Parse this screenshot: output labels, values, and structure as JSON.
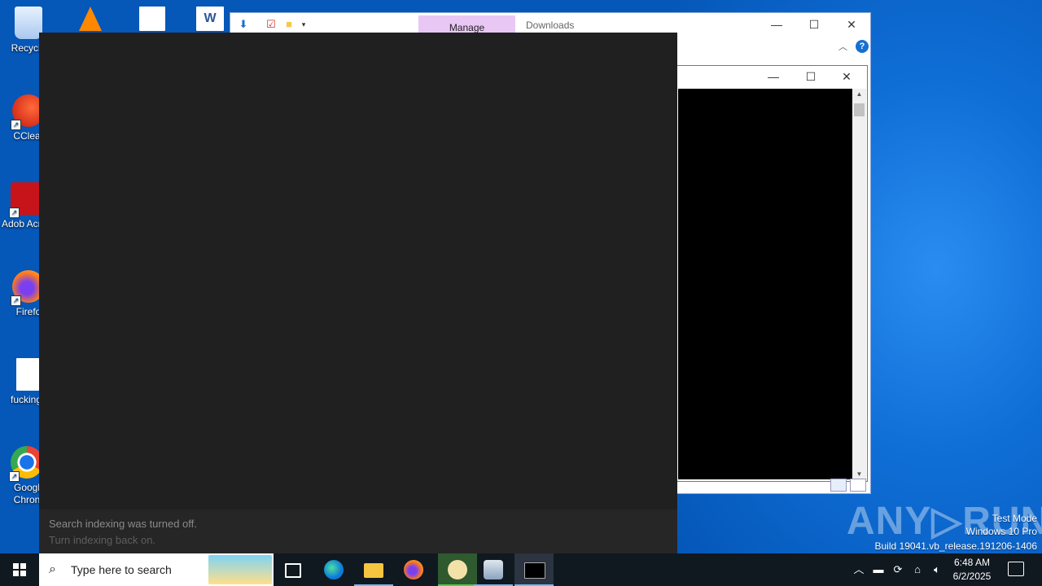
{
  "desktop": {
    "icons": [
      {
        "label": "Recycle"
      },
      {
        "label": "CClear"
      },
      {
        "label": "Adob Acrob"
      },
      {
        "label": "Firefo"
      },
      {
        "label": "fuckings"
      },
      {
        "label": "Googl Chron"
      }
    ]
  },
  "explorer": {
    "manage_tab": "Manage",
    "title": "Downloads"
  },
  "search_panel": {
    "footer_line1": "Search indexing was turned off.",
    "footer_line2": "Turn indexing back on."
  },
  "watermark": {
    "logo_text": "ANY RUN",
    "line1": "Test Mode",
    "line2": "Windows 10 Pro",
    "line3": "Build 19041.vb_release.191206-1406"
  },
  "taskbar": {
    "search_placeholder": "Type here to search",
    "time": "6:48 AM",
    "date": "6/2/2025"
  },
  "colors": {
    "desktop_blue": "#0a6fd8",
    "search_panel_bg": "#202020",
    "manage_tab": "#e9c7f5",
    "taskbar": "#101820"
  }
}
